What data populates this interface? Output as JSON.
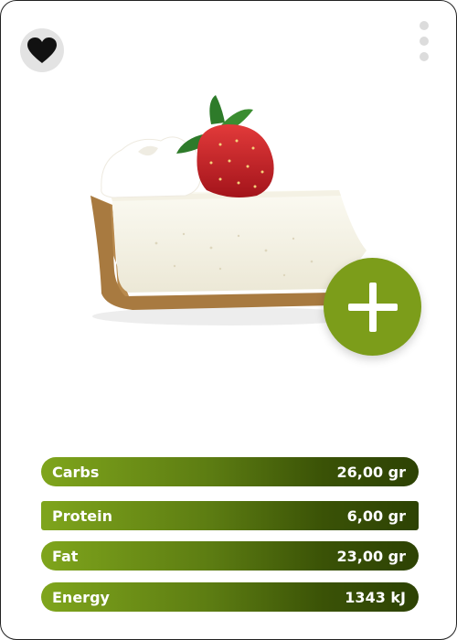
{
  "card": {
    "favorite_icon": "heart-icon",
    "more_icon": "vertical-dots-icon",
    "add_icon": "plus-icon",
    "accent_color": "#7c9d1a"
  },
  "nutrition": [
    {
      "label": "Carbs",
      "value": "26,00 gr"
    },
    {
      "label": "Protein",
      "value": "6,00 gr"
    },
    {
      "label": "Fat",
      "value": "23,00 gr"
    },
    {
      "label": "Energy",
      "value": "1343 kJ"
    }
  ]
}
